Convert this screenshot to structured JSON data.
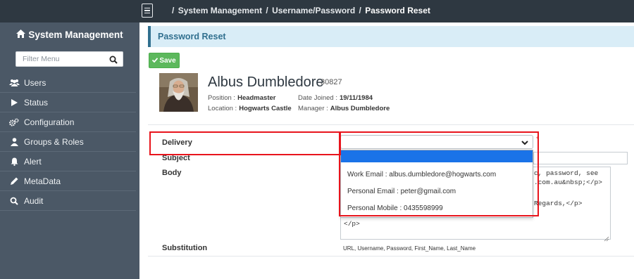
{
  "topbar": {
    "breadcrumb": [
      "System Management",
      "Username/Password",
      "Password Reset"
    ]
  },
  "sidebar": {
    "title": "System Management",
    "filter_placeholder": "Filter Menu",
    "items": [
      {
        "label": "Users",
        "icon": "users-icon"
      },
      {
        "label": "Status",
        "icon": "play-icon"
      },
      {
        "label": "Configuration",
        "icon": "cogs-icon"
      },
      {
        "label": "Groups & Roles",
        "icon": "user-icon"
      },
      {
        "label": "Alert",
        "icon": "bell-icon"
      },
      {
        "label": "MetaData",
        "icon": "pen-icon"
      },
      {
        "label": "Audit",
        "icon": "search-icon"
      }
    ]
  },
  "panel": {
    "title": "Password Reset",
    "save_label": "Save"
  },
  "profile": {
    "name": "Albus Dumbledore",
    "id": "30827",
    "position_label": "Position :",
    "position": "Headmaster",
    "date_joined_label": "Date Joined :",
    "date_joined": "19/11/1984",
    "location_label": "Location :",
    "location": "Hogwarts Castle",
    "manager_label": "Manager :",
    "manager": "Albus Dumbledore"
  },
  "form": {
    "delivery_label": "Delivery",
    "subject_label": "Subject",
    "body_label": "Body",
    "substitution_label": "Substitution",
    "required_mark": "*",
    "body_lines": [
      "c, password, see",
      ".com.au&nbsp;</p>",
      "Regards,</p>",
      "</p>"
    ],
    "substitution_values": "URL, Username, Password, First_Name, Last_Name"
  },
  "delivery_dropdown": {
    "selected": "",
    "options": [
      "Work Email : albus.dumbledore@hogwarts.com",
      "Personal Email : peter@gmail.com",
      "Personal Mobile : 0435598999"
    ]
  },
  "colors": {
    "topbar": "#2e3841",
    "sidebar": "#4b5866",
    "panel_header_bg": "#d9edf7",
    "panel_header_text": "#31708f",
    "save_button": "#5cb85c",
    "highlight": "#e8141c",
    "dropdown_selected": "#1a73e8"
  }
}
